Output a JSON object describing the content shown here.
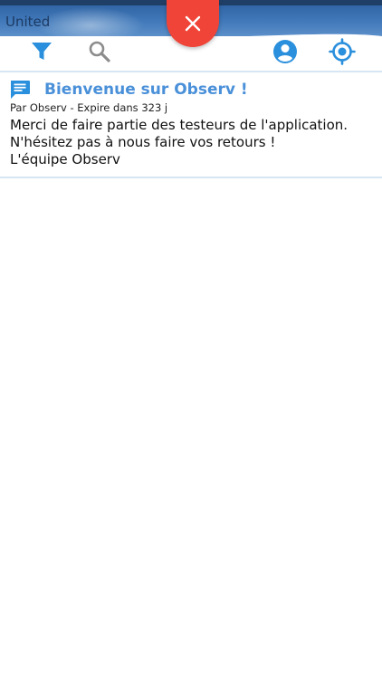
{
  "map": {
    "label": "United"
  },
  "nav": {
    "accent_color": "#2a8fdc",
    "inactive_color": "#8c8c8c",
    "close_color": "#f04438",
    "icons": [
      "filter-icon",
      "search-icon",
      "account-icon",
      "locate-icon"
    ]
  },
  "message": {
    "icon": "message-icon",
    "title": "Bienvenue sur Observ !",
    "meta": "Par Observ - Expire dans 323 j",
    "body_lines": [
      "Merci de faire partie des testeurs de l'application.",
      "N'hésitez pas à nous faire vos retours !",
      "L'équipe Observ"
    ],
    "title_color": "#4a90d9"
  }
}
